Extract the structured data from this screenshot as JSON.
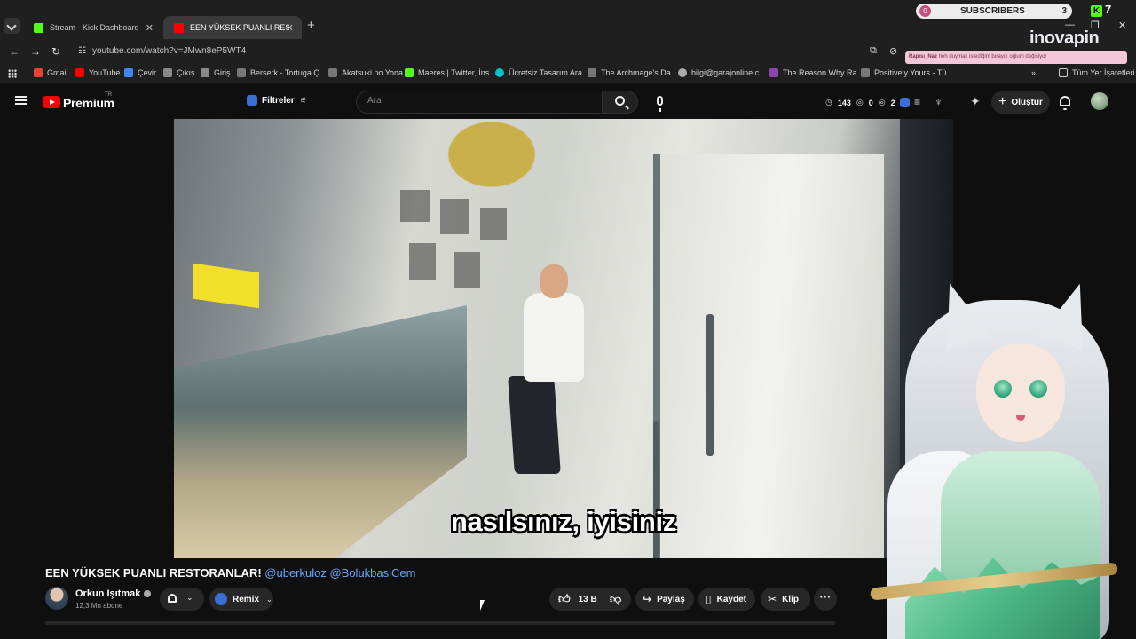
{
  "browser": {
    "tabs": [
      {
        "title": "Stream - Kick Dashboard",
        "icon_color": "#53fc18"
      },
      {
        "title": "EEN YÜKSEK PUANLI RESTORAN",
        "icon_color": "#ff0000"
      }
    ],
    "address": {
      "url": "youtube.com/watch?v=JMwn8eP5WT4"
    },
    "bookmarks": [
      {
        "label": "Gmail",
        "icon_color": "#ea4335"
      },
      {
        "label": "YouTube",
        "icon_color": "#ff0000"
      },
      {
        "label": "Çevir",
        "icon_color": "#4285f4"
      },
      {
        "label": "Çıkış",
        "icon_color": "#888888"
      },
      {
        "label": "Giriş",
        "icon_color": "#888888"
      },
      {
        "label": "Berserk - Tortuga Ç...",
        "icon_color": "#777777"
      },
      {
        "label": "Akatsuki no Yona",
        "icon_color": "#777777"
      },
      {
        "label": "Maeres | Twitter, İns...",
        "icon_color": "#53fc18"
      },
      {
        "label": "Ücretsiz Tasarım Ara...",
        "icon_color": "#00c4cc"
      },
      {
        "label": "The Archmage's Da...",
        "icon_color": "#777777"
      },
      {
        "label": "bilgi@garajonline.c...",
        "icon_color": "#aaaaaa"
      },
      {
        "label": "The Reason Why Ra...",
        "icon_color": "#8e44ad"
      },
      {
        "label": "Positively Yours - Tü...",
        "icon_color": "#777777"
      }
    ],
    "bookmarks_more": "»",
    "all_bookmarks": "Tüm Yer İşaretleri"
  },
  "overlay": {
    "subscribers_label": "SUBSCRIBERS",
    "subscribers_left": "0",
    "subscribers_count": "3",
    "kick_count": "7",
    "brand": "inovapin",
    "note_title": "Rapısı_Naz",
    "note_text": "heh duymak istediğim bıraydı oğlum değişiyor"
  },
  "youtube": {
    "logo_text": "Premium",
    "region": "TR",
    "filters_label": "Filtreler",
    "search_placeholder": "Ara",
    "stats": {
      "views": "143",
      "a": "0",
      "b": "2"
    },
    "create_label": "Oluştur"
  },
  "video": {
    "subtitle": "nasılsınız, iyisiniz",
    "title_main": "EEN YÜKSEK PUANLI RESTORANLAR!",
    "title_tags": "@uberkuloz @BolukbasiCem",
    "channel": "Orkun Işıtmak",
    "subscribers": "12,3 Mn abone",
    "remix_label": "Remix",
    "likes": "13 B",
    "share_label": "Paylaş",
    "save_label": "Kaydet",
    "clip_label": "Klip"
  }
}
